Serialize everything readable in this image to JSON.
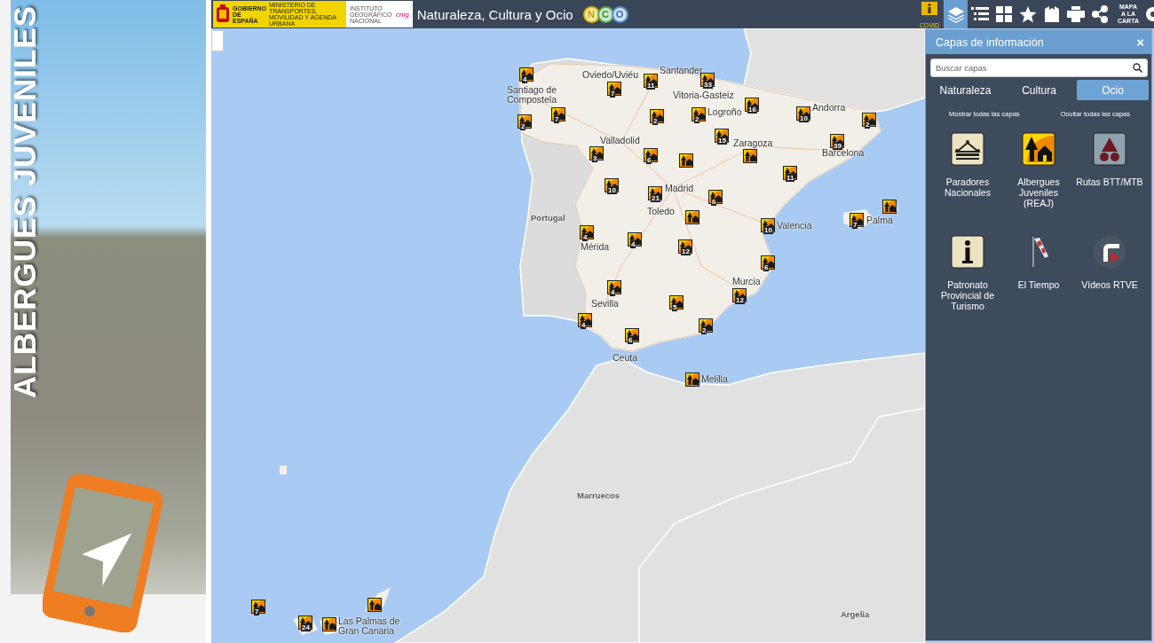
{
  "banner": {
    "title": "ALBERGUES JUVENILES"
  },
  "header": {
    "logo_texts": [
      "GOBIERNO DE ESPAÑA",
      "MINISTERIO DE TRANSPORTES, MOVILIDAD Y AGENDA URBANA",
      "INSTITUTO GEOGRÁFICO NACIONAL",
      "cnig"
    ],
    "title": "Naturaleza, Cultura y Ocio",
    "nco_letters": [
      "N",
      "C",
      "O"
    ],
    "tools": [
      {
        "kind": "covid",
        "label": "COVID",
        "selected": false
      },
      {
        "kind": "layers",
        "selected": true
      },
      {
        "kind": "list",
        "selected": false
      },
      {
        "kind": "grid",
        "selected": false
      },
      {
        "kind": "star",
        "selected": false
      },
      {
        "kind": "bookmark",
        "selected": false
      },
      {
        "kind": "print",
        "selected": false
      },
      {
        "kind": "share",
        "selected": false
      },
      {
        "kind": "custom_map",
        "label_lines": [
          "MAPA",
          "A LA",
          "CARTA"
        ],
        "selected": false
      },
      {
        "kind": "partial",
        "selected": false
      }
    ]
  },
  "map": {
    "labels": [
      {
        "text": "Santander",
        "kind": "city"
      },
      {
        "text": "Oviedo/Uviéu",
        "kind": "city"
      },
      {
        "text": "Santiago de Compostela",
        "kind": "city"
      },
      {
        "text": "Vitoria-Gasteiz",
        "kind": "city"
      },
      {
        "text": "Logroño",
        "kind": "city"
      },
      {
        "text": "Andorra",
        "kind": "city"
      },
      {
        "text": "Zaragoza",
        "kind": "city"
      },
      {
        "text": "Barcelona",
        "kind": "city"
      },
      {
        "text": "Valladolid",
        "kind": "city"
      },
      {
        "text": "Madrid",
        "kind": "city"
      },
      {
        "text": "Toledo",
        "kind": "city"
      },
      {
        "text": "Portugal",
        "kind": "country"
      },
      {
        "text": "Valencia",
        "kind": "city"
      },
      {
        "text": "Palma",
        "kind": "city"
      },
      {
        "text": "Mérida",
        "kind": "city"
      },
      {
        "text": "Murcia",
        "kind": "city"
      },
      {
        "text": "Sevilla",
        "kind": "city"
      },
      {
        "text": "Ceuta",
        "kind": "city"
      },
      {
        "text": "Melilla",
        "kind": "city"
      },
      {
        "text": "Marruecos",
        "kind": "country"
      },
      {
        "text": "Argelia",
        "kind": "country"
      },
      {
        "text": "Las Palmas de Gran Canaria",
        "kind": "city"
      }
    ],
    "markers": [
      {
        "kind": "numbered",
        "count": "4"
      },
      {
        "kind": "numbered",
        "count": "7"
      },
      {
        "kind": "numbered",
        "count": "11"
      },
      {
        "kind": "numbered",
        "count": "33"
      },
      {
        "kind": "numbered",
        "count": "16"
      },
      {
        "kind": "numbered",
        "count": "10"
      },
      {
        "kind": "numbered",
        "count": "2"
      },
      {
        "kind": "numbered",
        "count": "2"
      },
      {
        "kind": "numbered",
        "count": "7"
      },
      {
        "kind": "numbered",
        "count": "2"
      },
      {
        "kind": "numbered",
        "count": "2"
      },
      {
        "kind": "numbered",
        "count": "15"
      },
      {
        "kind": "numbered",
        "count": "39"
      },
      {
        "kind": "numbered",
        "count": "3"
      },
      {
        "kind": "numbered",
        "count": "6"
      },
      {
        "kind": "single"
      },
      {
        "kind": "single"
      },
      {
        "kind": "numbered",
        "count": "11"
      },
      {
        "kind": "numbered",
        "count": "10"
      },
      {
        "kind": "numbered",
        "count": "21"
      },
      {
        "kind": "numbered",
        "count": "6"
      },
      {
        "kind": "single"
      },
      {
        "kind": "numbered",
        "count": "10"
      },
      {
        "kind": "numbered",
        "count": "7"
      },
      {
        "kind": "single"
      },
      {
        "kind": "numbered",
        "count": "4"
      },
      {
        "kind": "numbered",
        "count": "4"
      },
      {
        "kind": "numbered",
        "count": "12"
      },
      {
        "kind": "numbered",
        "count": "6"
      },
      {
        "kind": "numbered",
        "count": "4"
      },
      {
        "kind": "numbered",
        "count": "12"
      },
      {
        "kind": "numbered",
        "count": "5"
      },
      {
        "kind": "numbered",
        "count": "4"
      },
      {
        "kind": "numbered",
        "count": "6"
      },
      {
        "kind": "numbered",
        "count": "2"
      },
      {
        "kind": "single"
      },
      {
        "kind": "numbered",
        "count": "7"
      },
      {
        "kind": "numbered",
        "count": "24"
      },
      {
        "kind": "single"
      },
      {
        "kind": "single"
      }
    ]
  },
  "panel": {
    "title": "Capas de información",
    "close": "×",
    "search": {
      "placeholder": "Buscar capas"
    },
    "tabs": [
      {
        "label": "Naturaleza",
        "selected": false
      },
      {
        "label": "Cultura",
        "selected": false
      },
      {
        "label": "Ocio",
        "selected": true
      }
    ],
    "show_all": "Mostrar todas las capas",
    "hide_all": "Ocultar todas las capas",
    "layers": [
      {
        "kind": "parador",
        "label": "Paradores Nacionales"
      },
      {
        "kind": "hostel",
        "label": "Albergues Juveniles (REAJ)"
      },
      {
        "kind": "routes",
        "label": "Rutas BTT/MTB"
      },
      {
        "kind": "info",
        "label": "Patronato Provincial de Turismo"
      },
      {
        "kind": "weather",
        "label": "El Tiempo"
      },
      {
        "kind": "video",
        "label": "Vídeos RTVE"
      }
    ]
  }
}
